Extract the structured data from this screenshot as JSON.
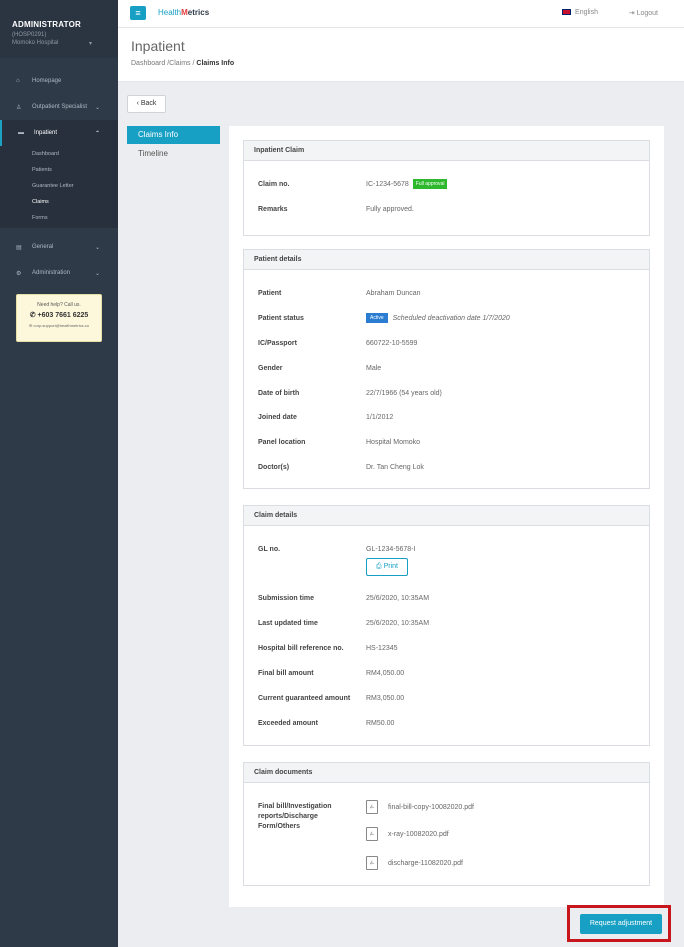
{
  "sidebar": {
    "admin_title": "ADMINISTRATOR",
    "admin_id": "(HOSP0291)",
    "hospital": "Momoko Hospital",
    "items": [
      {
        "label": "Homepage"
      },
      {
        "label": "Outpatient Specialist"
      },
      {
        "label": "Inpatient"
      },
      {
        "label": "General"
      },
      {
        "label": "Administration"
      }
    ],
    "inpatient_sub": [
      "Dashboard",
      "Patients",
      "Guarantee Letter",
      "Claims",
      "Forms"
    ],
    "help": {
      "title": "Need help? Call us.",
      "phone": "+603 7661 6225",
      "email": "corp.support@healthmetrics.co"
    }
  },
  "topbar": {
    "logo_a": "Health",
    "logo_b": "M",
    "logo_c": "etrics",
    "language": "English",
    "logout": "Logout"
  },
  "page": {
    "title": "Inpatient",
    "crumb1": "Dashboard",
    "crumb2": "/Claims",
    "crumb3": "Claims Info"
  },
  "back_label": "Back",
  "tabs": {
    "claims_info": "Claims Info",
    "timeline": "Timeline"
  },
  "inpatient_claim": {
    "header": "Inpatient Claim",
    "claim_no_label": "Claim no.",
    "claim_no": "IC-1234-5678",
    "approval_badge": "Full approval",
    "remarks_label": "Remarks",
    "remarks": "Fully approved."
  },
  "patient_details": {
    "header": "Patient details",
    "patient_label": "Patient",
    "patient": "Abraham Duncan",
    "status_label": "Patient status",
    "status_badge": "Active",
    "status_note": "Scheduled deactivation date 1/7/2020",
    "ic_label": "IC/Passport",
    "ic": "660722-10-5599",
    "gender_label": "Gender",
    "gender": "Male",
    "dob_label": "Date of birth",
    "dob": "22/7/1966 (54 years old)",
    "joined_label": "Joined date",
    "joined": "1/1/2012",
    "panel_label": "Panel location",
    "panel": "Hospital Momoko",
    "doctor_label": "Doctor(s)",
    "doctor": "Dr. Tan Cheng Lok"
  },
  "claim_details": {
    "header": "Claim details",
    "gl_label": "GL no.",
    "gl": "GL-1234-5678-I",
    "print": "Print",
    "submission_label": "Submission time",
    "submission": "25/6/2020, 10:35AM",
    "updated_label": "Last updated time",
    "updated": "25/6/2020, 10:35AM",
    "bill_ref_label": "Hospital bill reference no.",
    "bill_ref": "HS-12345",
    "final_label": "Final bill amount",
    "final": "RM4,050.00",
    "guaranteed_label": "Current guaranteed amount",
    "guaranteed": "RM3,050.00",
    "exceeded_label": "Exceeded amount",
    "exceeded": "RM50.00"
  },
  "claim_documents": {
    "header": "Claim documents",
    "label_1": "Final bill/Investigation",
    "label_2": "reports/Discharge",
    "label_3": "Form/Others",
    "files": [
      "final-bill-copy-10082020.pdf",
      "x-ray-10082020.pdf",
      "discharge-11082020.pdf"
    ]
  },
  "request_adjustment": "Request adjustment"
}
